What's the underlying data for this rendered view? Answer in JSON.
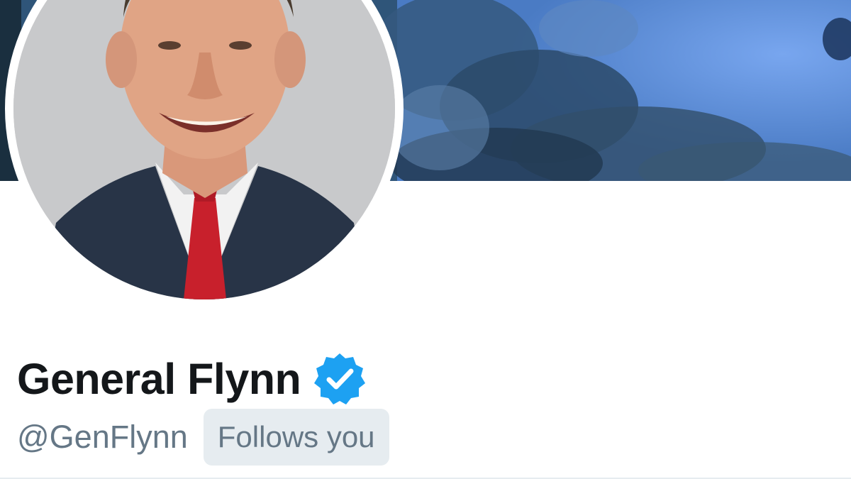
{
  "profile": {
    "display_name": "General Flynn",
    "handle": "@GenFlynn",
    "follows_badge": "Follows you",
    "verified": true
  },
  "banner": {
    "description_icon": "header-photo"
  },
  "avatar": {
    "icon": "profile-photo"
  },
  "colors": {
    "name_text": "#14171a",
    "secondary_text": "#657786",
    "badge_background": "#e6ecf0",
    "verified_blue": "#1da1f2"
  }
}
